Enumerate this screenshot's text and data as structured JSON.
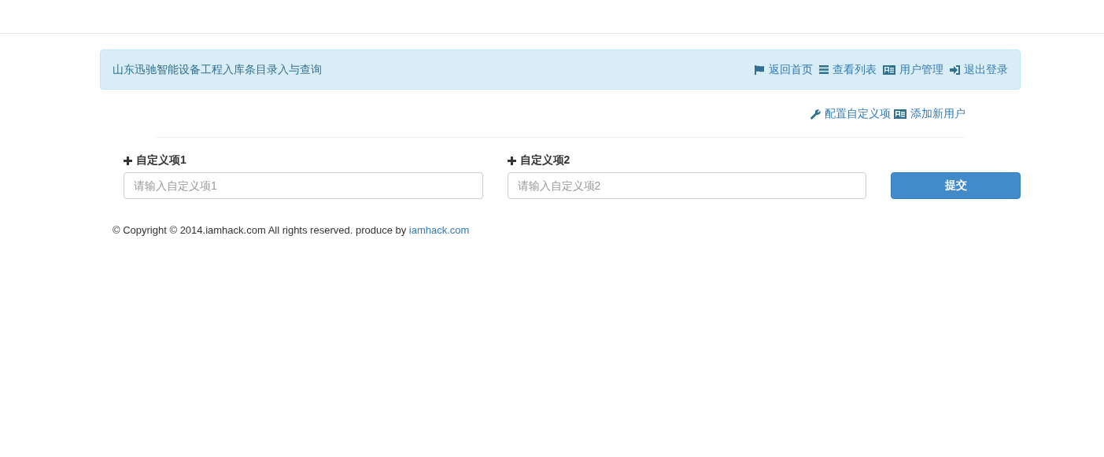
{
  "header": {
    "title": "山东迅驰智能设备工程入库条目录入与查询",
    "links": [
      {
        "label": "返回首页"
      },
      {
        "label": "查看列表"
      },
      {
        "label": "用户管理"
      },
      {
        "label": "退出登录"
      }
    ]
  },
  "toolbar": {
    "links": [
      {
        "label": "配置自定义项"
      },
      {
        "label": "添加新用户"
      }
    ]
  },
  "form": {
    "fields": [
      {
        "label": "自定义项1",
        "placeholder": "请输入自定义项1"
      },
      {
        "label": "自定义项2",
        "placeholder": "请输入自定义项2"
      }
    ],
    "submit": "提交"
  },
  "footer": {
    "text": "© Copyright © 2014.iamhack.com All rights reserved. produce by",
    "link": "iamhack.com"
  }
}
